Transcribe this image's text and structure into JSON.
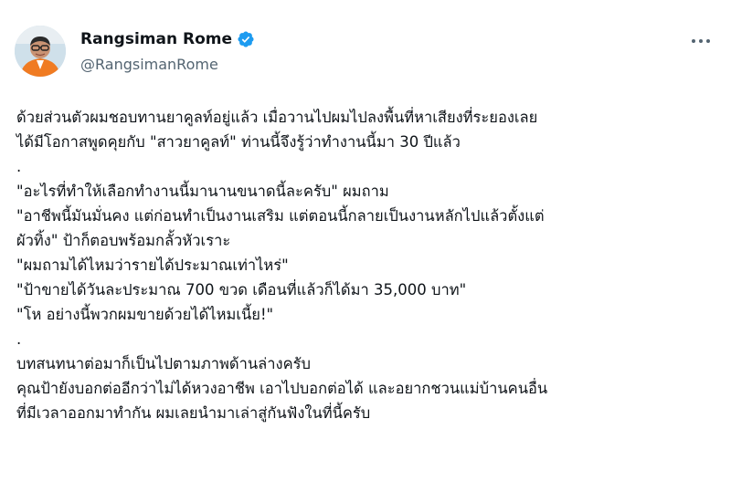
{
  "author": {
    "name": "Rangsiman Rome",
    "handle": "@RangsimanRome"
  },
  "icons": {
    "verified": "verified-badge-icon",
    "more": "more-options-icon"
  },
  "colors": {
    "verified_blue": "#1d9bf0",
    "handle_gray": "#536471",
    "text": "#0f1419",
    "avatar_shirt": "#f07b22"
  },
  "post": {
    "lines": [
      "ด้วยส่วนตัวผมชอบทานยาคูลท์อยู่แล้ว เมื่อวานไปผมไปลงพื้นที่หาเสียงที่ระยองเลย",
      "ได้มีโอกาสพูดคุยกับ \"สาวยาคูลท์\" ท่านนี้จึงรู้ว่าทำงานนี้มา 30 ปีแล้ว",
      ".",
      "\"อะไรที่ทำให้เลือกทำงานนี้มานานขนาดนี้ละครับ\" ผมถาม",
      "\"อาชีพนี้มันมั่นคง แต่ก่อนทำเป็นงานเสริม แต่ตอนนี้กลายเป็นงานหลักไปแล้วตั้งแต่",
      "ผัวทิ้ง\" ป้าก็ตอบพร้อมกลั้วหัวเราะ",
      "\"ผมถามได้ไหมว่ารายได้ประมาณเท่าไหร่\"",
      "\"ป้าขายได้วันละประมาณ 700 ขวด เดือนที่แล้วก็ได้มา 35,000 บาท\"",
      "\"โห อย่างนี้พวกผมขายด้วยได้ไหมเนี้ย!\"",
      ".",
      "บทสนทนาต่อมาก็เป็นไปตามภาพด้านล่างครับ",
      "คุณป้ายังบอกต่ออีกว่าไม่ได้หวงอาชีพ เอาไปบอกต่อได้ และอยากชวนแม่บ้านคนอื่น",
      "ที่มีเวลาออกมาทำกัน ผมเลยนำมาเล่าสู่กันฟังในที่นี้ครับ"
    ]
  }
}
